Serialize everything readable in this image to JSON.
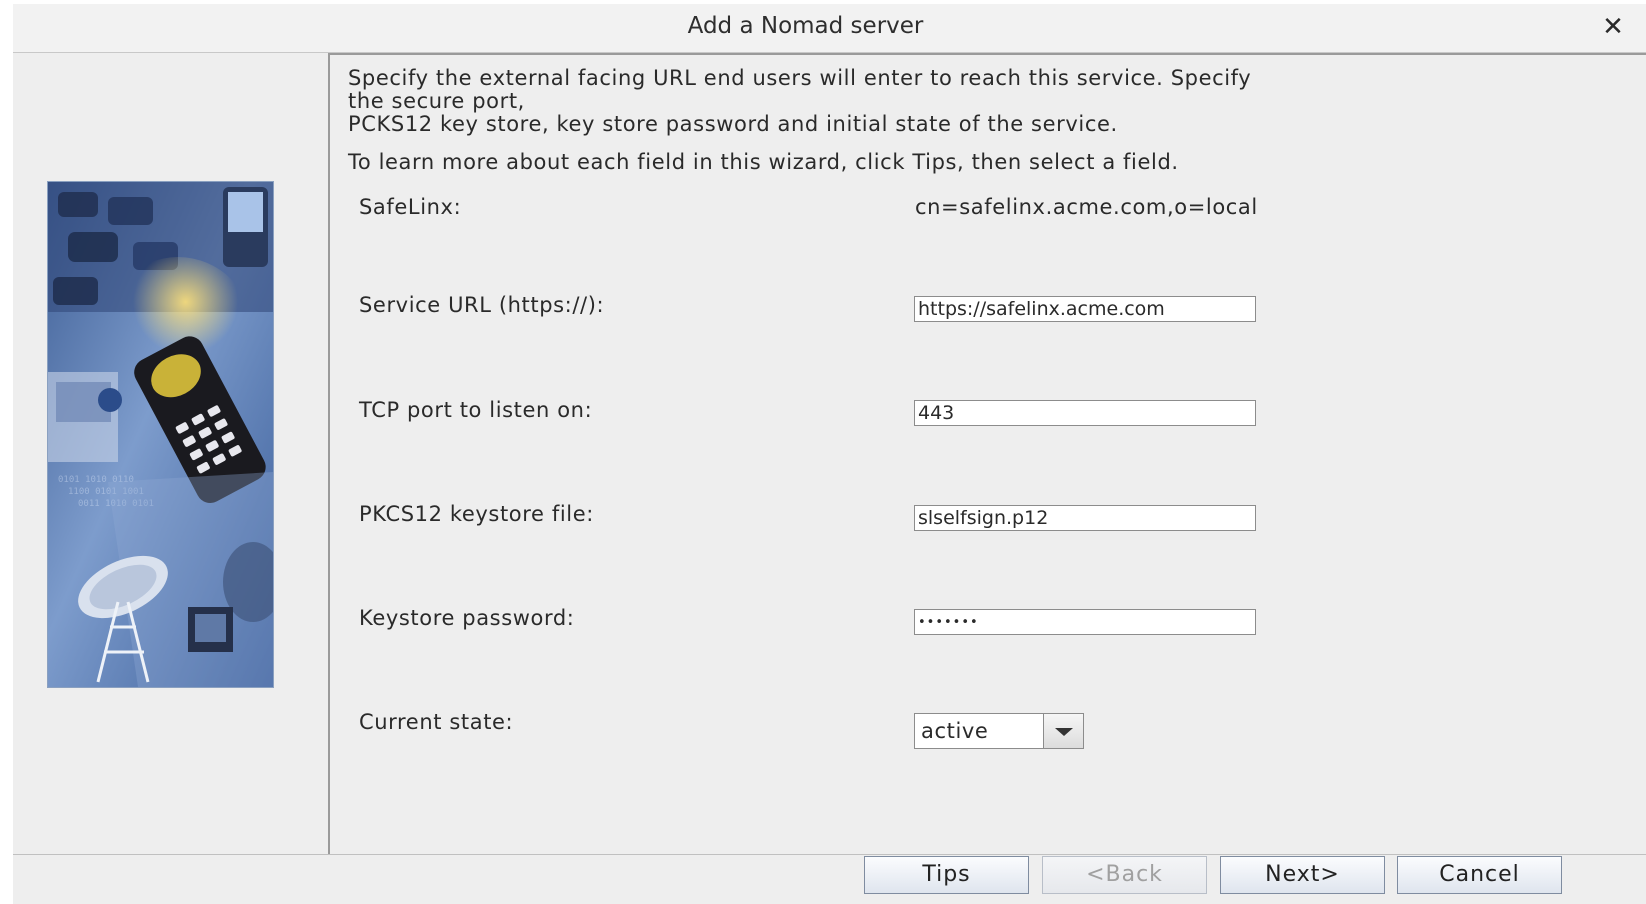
{
  "window": {
    "title": "Add a Nomad server",
    "close_glyph": "✕"
  },
  "intro": {
    "line1": "Specify the external facing URL end users will enter to reach this service.  Specify",
    "line2": "the secure port,",
    "line3": "PCKS12 key store, key store password and initial state of the service.",
    "line4": "To learn more about each field in this wizard, click Tips, then select a field."
  },
  "fields": {
    "safelinx": {
      "label": "SafeLinx:",
      "value": "cn=safelinx.acme.com,o=local"
    },
    "service_url": {
      "label": "Service URL (https://):",
      "value": "https://safelinx.acme.com"
    },
    "tcp_port": {
      "label": "TCP port to listen on:",
      "value": "443"
    },
    "keystore_file": {
      "label": "PKCS12 keystore file:",
      "value": "slselfsign.p12"
    },
    "keystore_password": {
      "label": "Keystore password:",
      "value": "•••••••"
    },
    "current_state": {
      "label": "Current state:",
      "value": "active"
    }
  },
  "buttons": {
    "tips": "Tips",
    "back": "<Back",
    "next": "Next>",
    "cancel": "Cancel"
  },
  "icons": {
    "close": "close-icon",
    "dropdown": "chevron-down-icon",
    "side_image": "wizard-side-image"
  },
  "colors": {
    "dialog_bg": "#eeeeee",
    "button_border": "#7f8ca0",
    "image_blue": "#4f78b5"
  }
}
